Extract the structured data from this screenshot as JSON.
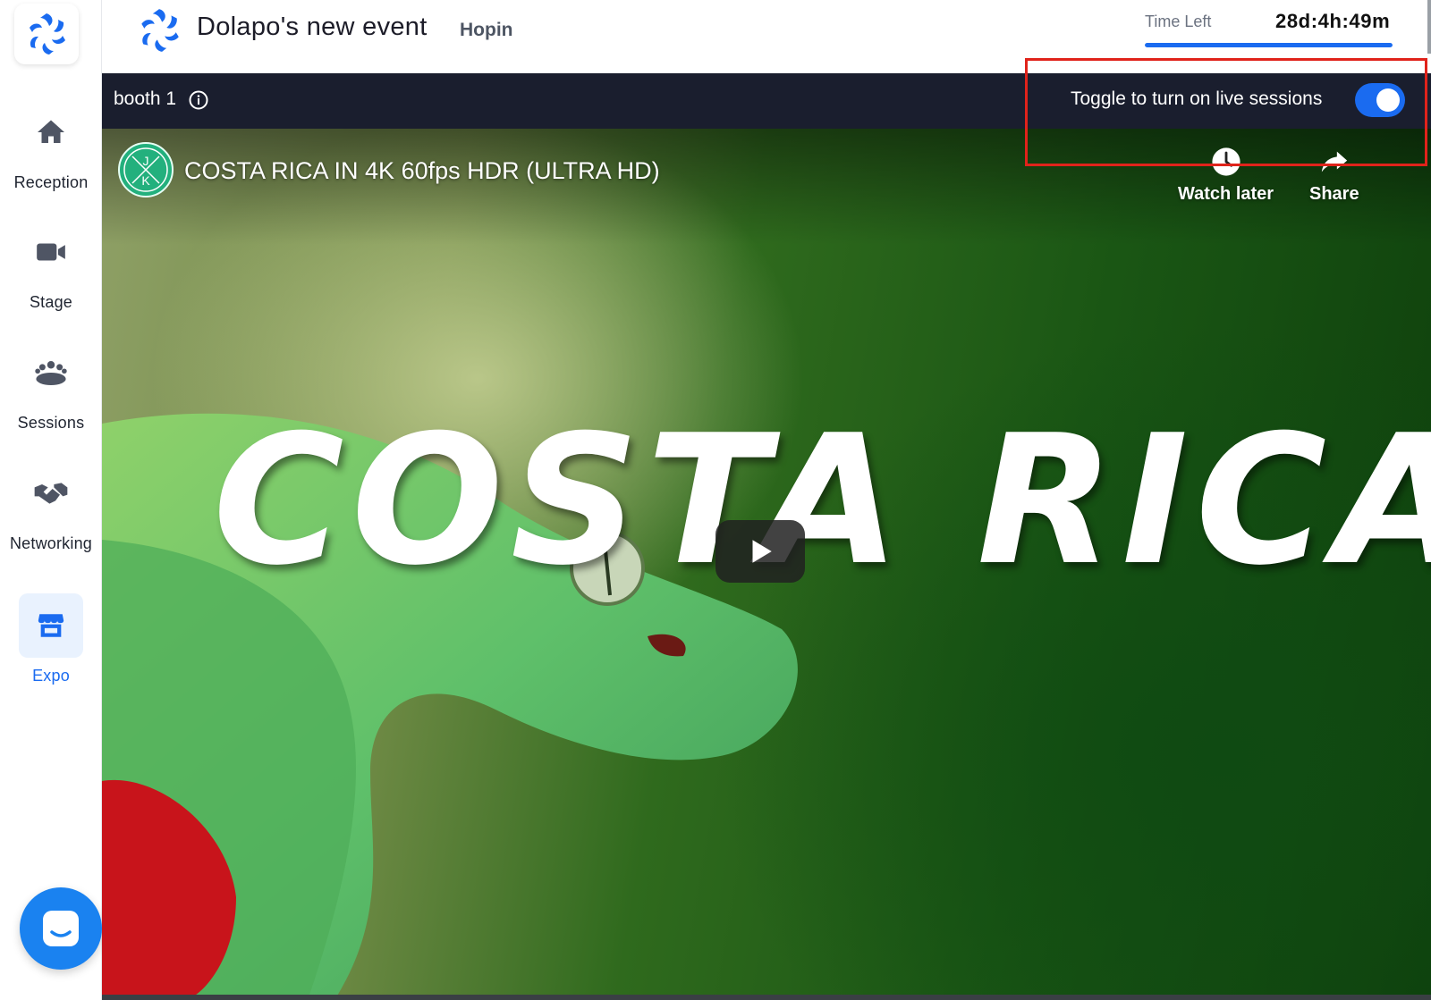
{
  "sidebar": {
    "items": [
      {
        "label": "Reception",
        "icon": "home-icon"
      },
      {
        "label": "Stage",
        "icon": "video-camera-icon"
      },
      {
        "label": "Sessions",
        "icon": "group-icon"
      },
      {
        "label": "Networking",
        "icon": "handshake-icon"
      },
      {
        "label": "Expo",
        "icon": "booth-icon",
        "active": true
      }
    ]
  },
  "header": {
    "event_title": "Dolapo's new event",
    "organizer": "Hopin",
    "time_left_label": "Time Left",
    "time_left_value": "28d:4h:49m",
    "time_left_progress": 1.0
  },
  "booth": {
    "name": "booth 1",
    "live_toggle_label": "Toggle to turn on live sessions",
    "live_toggle_on": true
  },
  "video": {
    "channel_initials": [
      "J",
      "K"
    ],
    "title": "COSTA RICA IN 4K 60fps HDR (ULTRA HD)",
    "overlay_text": "COSTA RICA",
    "actions": {
      "watch_later": "Watch later",
      "share": "Share"
    }
  },
  "colors": {
    "accent": "#1a6bf0",
    "booth_bar": "#1a1e2e",
    "annotation": "#e0231b",
    "chat": "#1a82f0"
  }
}
